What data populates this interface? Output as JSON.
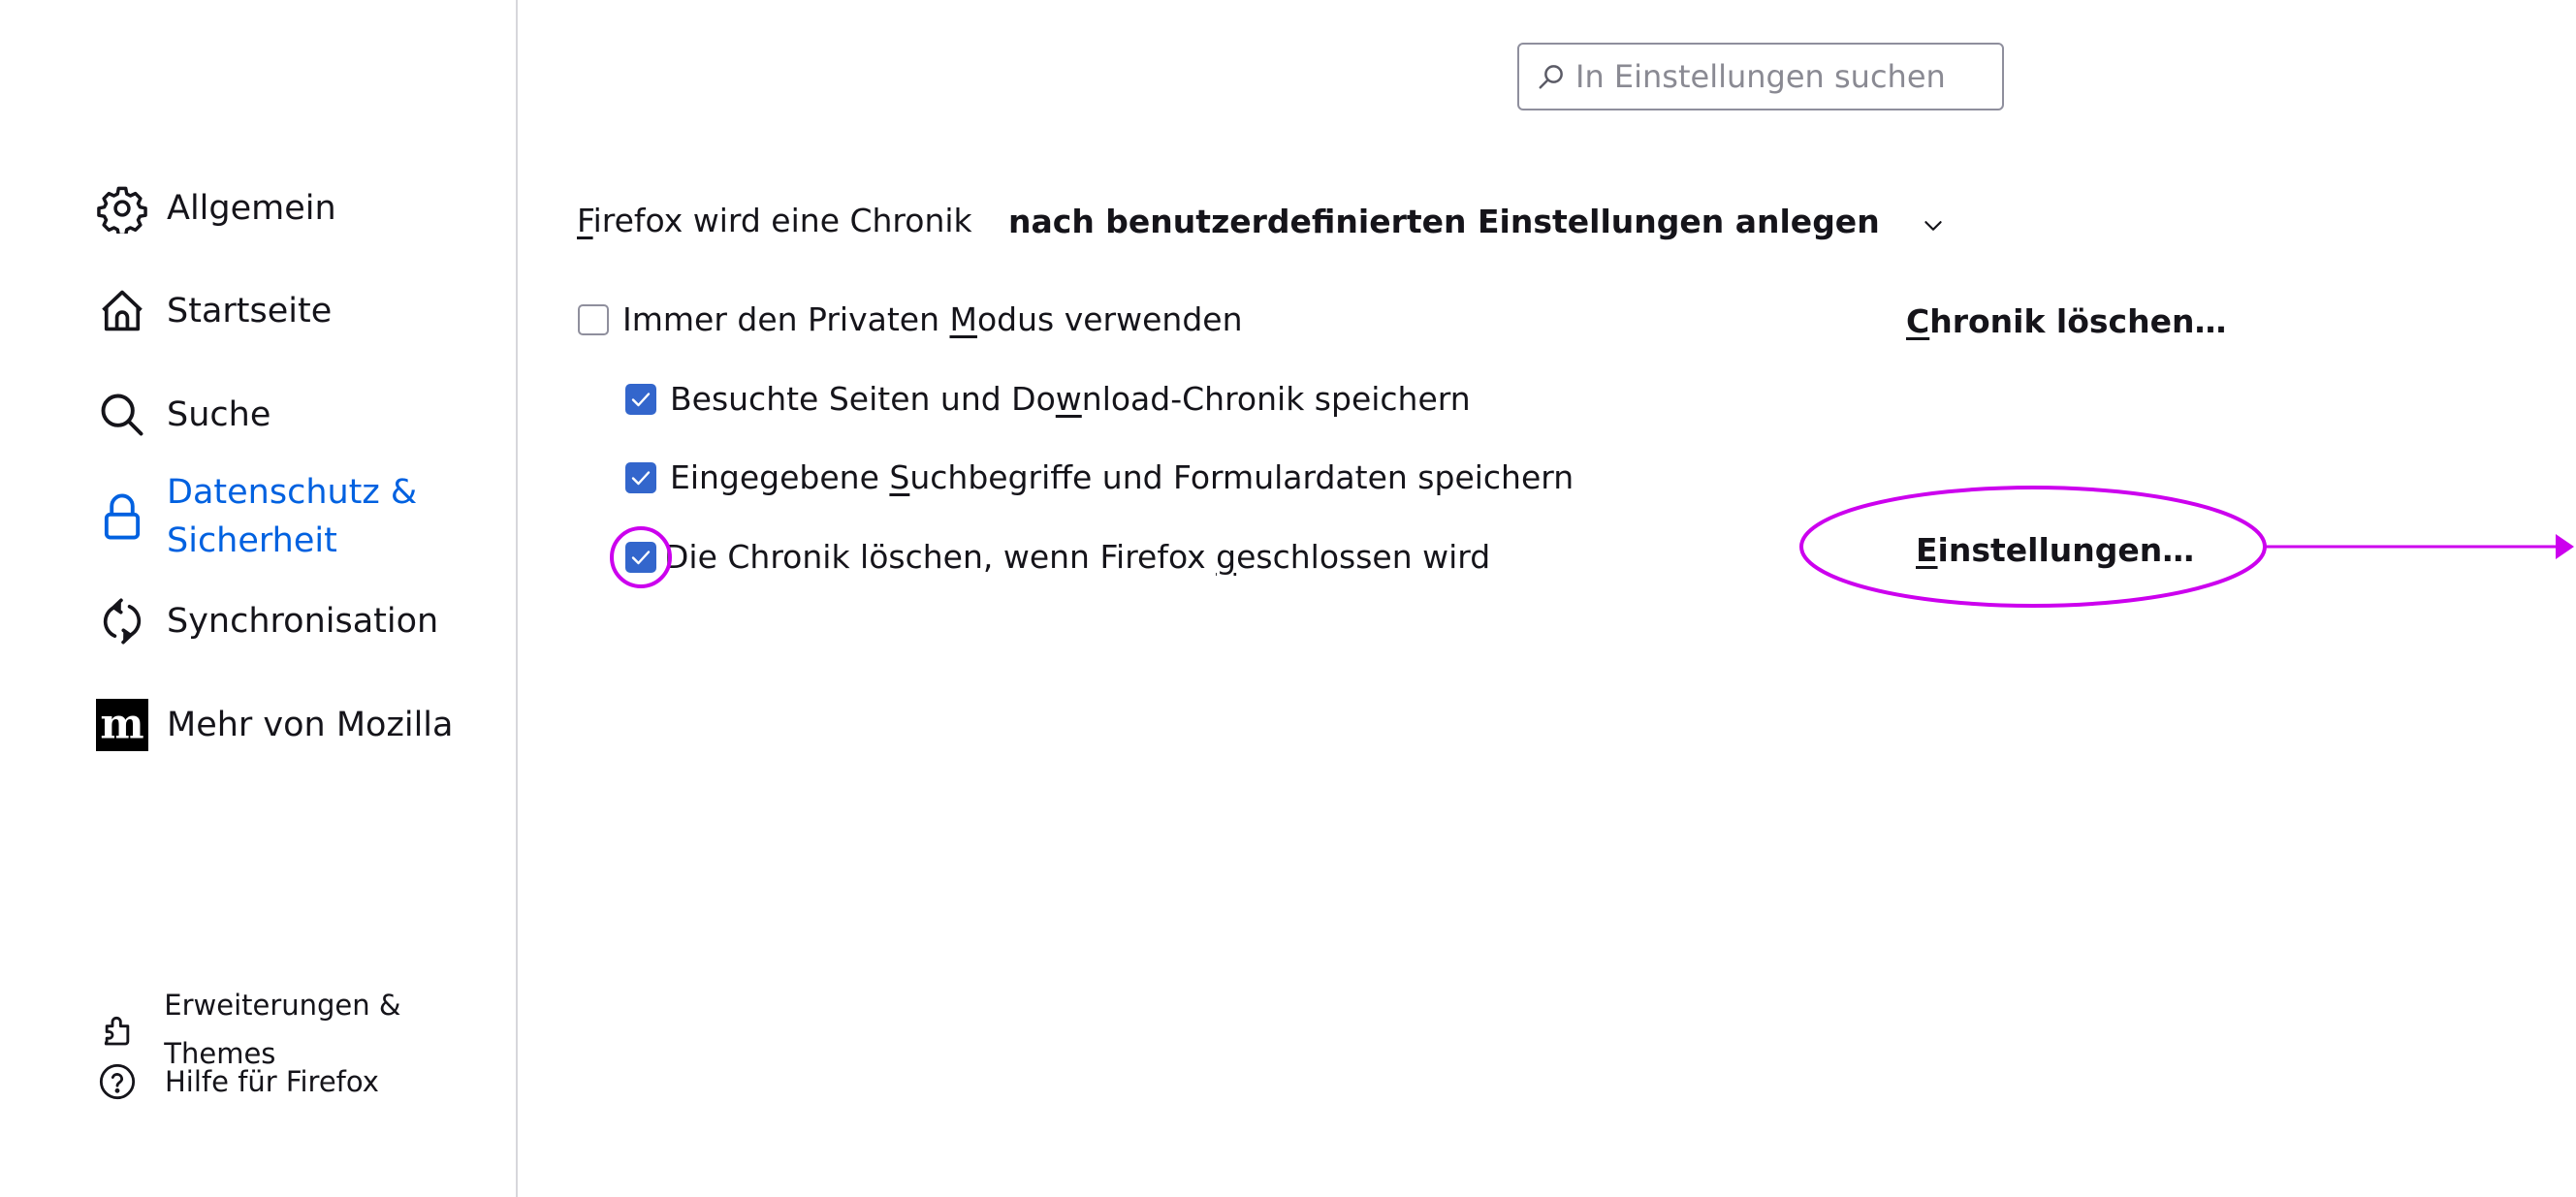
{
  "sidebar": {
    "items": [
      {
        "label": "Allgemein",
        "icon": "gear-icon",
        "active": false
      },
      {
        "label": "Startseite",
        "icon": "home-icon",
        "active": false
      },
      {
        "label": "Suche",
        "icon": "search-icon",
        "active": false
      },
      {
        "label_line1": "Datenschutz &",
        "label_line2": "Sicherheit",
        "icon": "lock-icon",
        "active": true
      },
      {
        "label": "Synchronisation",
        "icon": "sync-icon",
        "active": false
      },
      {
        "label": "Mehr von Mozilla",
        "icon": "mozilla-m-icon",
        "active": false
      }
    ],
    "footer": [
      {
        "label": "Erweiterungen & Themes",
        "icon": "puzzle-icon"
      },
      {
        "label": "Hilfe für Firefox",
        "icon": "help-icon"
      }
    ],
    "active_color": "#0061e0"
  },
  "search": {
    "placeholder": "In Einstellungen suchen",
    "value": ""
  },
  "history": {
    "label_access": "F",
    "label_rest": "irefox wird eine Chronik",
    "selected_option": "nach benutzerdefinierten Einstellungen anlegen",
    "clear_button": {
      "access": "C",
      "rest": "hronik löschen…"
    },
    "checkboxes": [
      {
        "pre": "Immer den Privaten ",
        "access": "M",
        "post": "odus verwenden",
        "checked": false
      },
      {
        "pre": "Besuchte Seiten und Do",
        "access": "w",
        "post": "nload-Chronik speichern",
        "checked": true
      },
      {
        "pre": "Eingegebene ",
        "access": "S",
        "post": "uchbegriffe und Formulardaten speichern",
        "checked": true
      },
      {
        "pre": "Die Chronik löschen, wenn Firefox ",
        "access": "g",
        "post": "eschlossen wird",
        "checked": true
      }
    ],
    "settings_button": {
      "access": "E",
      "rest": "instellungen…"
    }
  },
  "colors": {
    "checkbox": "#3366cc",
    "annotation": "#cc00ee"
  }
}
